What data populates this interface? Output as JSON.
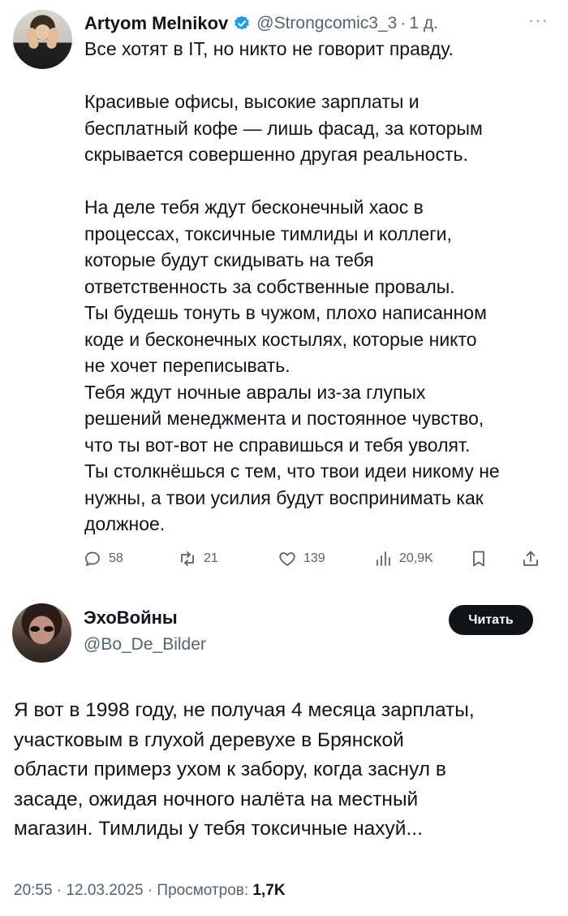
{
  "tweet1": {
    "author_name": "Artyom Melnikov",
    "handle": "@Strongcomic3_3",
    "time": "1 д.",
    "separator": "·",
    "more": "···",
    "body": "Все хотят в IT, но никто не говорит правду.\n\nКрасивые офисы, высокие зарплаты и\nбесплатный кофе — лишь фасад, за которым\nскрывается совершенно другая реальность.\n\nНа деле тебя ждут бесконечный хаос в\nпроцессах, токсичные тимлиды и коллеги,\nкоторые будут скидывать на тебя\nответственность за собственные провалы.\nТы будешь тонуть в чужом, плохо написанном\nкоде и бесконечных костылях, которые никто\nне хочет переписывать.\nТебя ждут ночные авралы из-за глупых\nрешений менеджмента и постоянное чувство,\nчто ты вот-вот не справишься и тебя уволят.\nТы столкнёшься с тем, что твои идеи никому не\nнужны, а твои усилия будут воспринимать как\nдолжное.",
    "actions": {
      "replies": "58",
      "reposts": "21",
      "likes": "139",
      "views": "20,9K"
    },
    "icons": [
      "verified-badge-icon",
      "reply-icon",
      "repost-icon",
      "like-icon",
      "views-icon",
      "bookmark-icon",
      "share-icon"
    ]
  },
  "tweet2": {
    "author_name": "ЭхоВойны",
    "handle": "@Bo_De_Bilder",
    "follow_button": "Читать",
    "body": "Я вот в 1998 году, не получая 4 месяца зарплаты,\nучастковым в глухой деревухе в Брянской\nобласти примерз ухом к забору, когда заснул в\nзасаде, ожидая ночного налёта на местный\nмагазин. Тимлиды у тебя токсичные нахуй...",
    "time": "20:55",
    "date": "12.03.2025",
    "views_label": "Просмотров:",
    "views_count": "1,7K"
  },
  "colors": {
    "text": "#0f1419",
    "secondary": "#536471",
    "verified": "#1d9bf0",
    "button_bg": "#0f1419"
  }
}
